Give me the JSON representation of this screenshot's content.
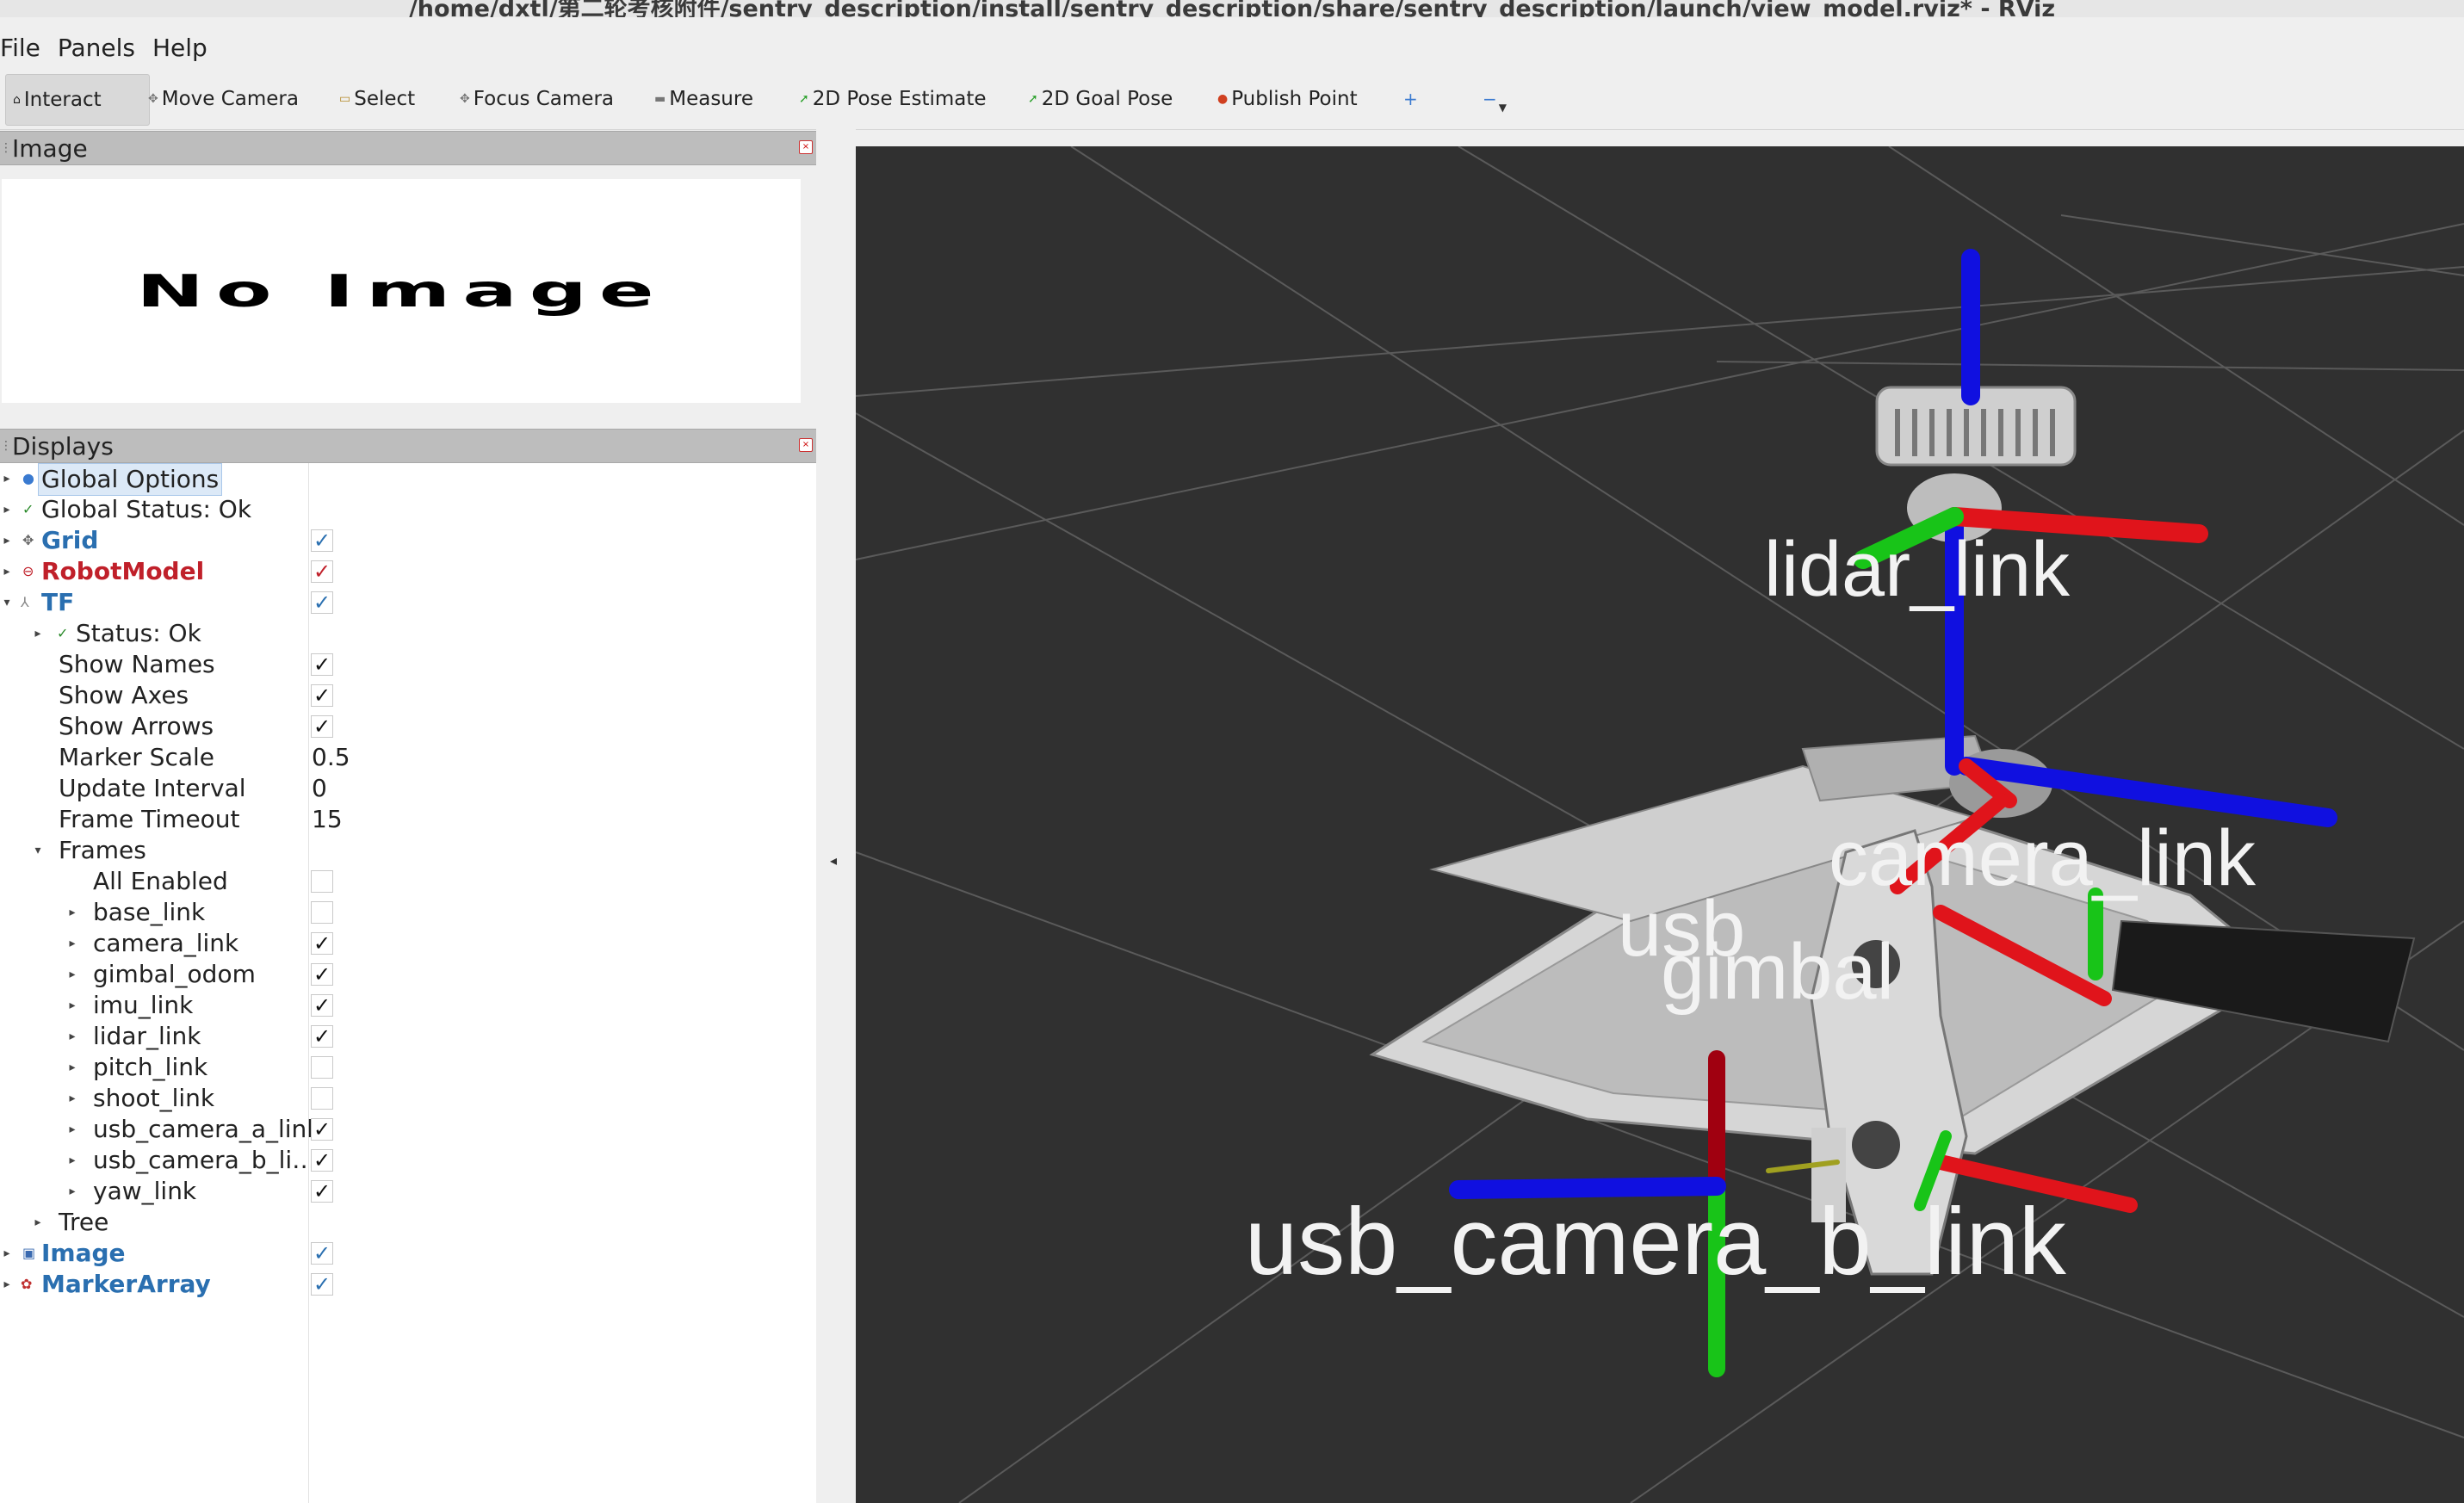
{
  "window": {
    "title": "/home/dxtl/第二轮考核附件/sentry_description/install/sentry_description/share/sentry_description/launch/view_model.rviz* - RViz"
  },
  "menu": [
    "File",
    "Panels",
    "Help"
  ],
  "toolbar": {
    "interact": "Interact",
    "move_camera": "Move Camera",
    "select": "Select",
    "focus_camera": "Focus Camera",
    "measure": "Measure",
    "pose_estimate": "2D Pose Estimate",
    "goal_pose": "2D Goal Pose",
    "publish_point": "Publish Point",
    "add_tool": "+",
    "remove_tool": "−"
  },
  "image_panel": {
    "title": "Image",
    "placeholder": "No Image"
  },
  "displays_panel": {
    "title": "Displays",
    "global_options": "Global Options",
    "global_status": "Global Status: Ok",
    "grid": "Grid",
    "robot_model": "RobotModel",
    "tf": "TF",
    "tf_status": "Status: Ok",
    "show_names": "Show Names",
    "show_axes": "Show Axes",
    "show_arrows": "Show Arrows",
    "marker_scale": "Marker Scale",
    "marker_scale_value": "0.5",
    "update_interval": "Update Interval",
    "update_interval_value": "0",
    "frame_timeout": "Frame Timeout",
    "frame_timeout_value": "15",
    "frames": "Frames",
    "all_enabled": "All Enabled",
    "frame_list": [
      {
        "name": "base_link",
        "checked": false
      },
      {
        "name": "camera_link",
        "checked": true
      },
      {
        "name": "gimbal_odom",
        "checked": true
      },
      {
        "name": "imu_link",
        "checked": true
      },
      {
        "name": "lidar_link",
        "checked": true
      },
      {
        "name": "pitch_link",
        "checked": false
      },
      {
        "name": "shoot_link",
        "checked": false
      },
      {
        "name": "usb_camera_a_link",
        "checked": true
      },
      {
        "name": "usb_camera_b_li…",
        "checked": true
      },
      {
        "name": "yaw_link",
        "checked": true
      }
    ],
    "tree": "Tree",
    "image": "Image",
    "marker_array": "MarkerArray"
  },
  "viewport": {
    "labels": {
      "lidar": "lidar_link",
      "camera": "camera_link",
      "gimbal": "gimbal",
      "usb": "usb",
      "usb_b": "usb_camera_b_link"
    },
    "colors": {
      "background": "#303030",
      "x_axis": "#e0141b",
      "y_axis": "#18c418",
      "z_axis": "#1010e0"
    }
  }
}
